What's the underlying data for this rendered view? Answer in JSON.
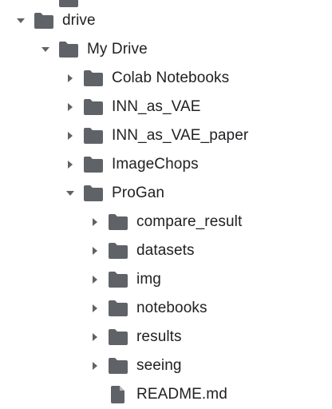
{
  "file_tree": {
    "items": [
      {
        "label": "",
        "depth": 1,
        "type": "folder",
        "expanded": false,
        "has_children": false
      },
      {
        "label": "drive",
        "depth": 0,
        "type": "folder",
        "expanded": true,
        "has_children": true
      },
      {
        "label": "My Drive",
        "depth": 1,
        "type": "folder",
        "expanded": true,
        "has_children": true
      },
      {
        "label": "Colab Notebooks",
        "depth": 2,
        "type": "folder",
        "expanded": false,
        "has_children": true
      },
      {
        "label": "INN_as_VAE",
        "depth": 2,
        "type": "folder",
        "expanded": false,
        "has_children": true
      },
      {
        "label": "INN_as_VAE_paper",
        "depth": 2,
        "type": "folder",
        "expanded": false,
        "has_children": true
      },
      {
        "label": "ImageChops",
        "depth": 2,
        "type": "folder",
        "expanded": false,
        "has_children": true
      },
      {
        "label": "ProGan",
        "depth": 2,
        "type": "folder",
        "expanded": true,
        "has_children": true
      },
      {
        "label": "compare_result",
        "depth": 3,
        "type": "folder",
        "expanded": false,
        "has_children": true
      },
      {
        "label": "datasets",
        "depth": 3,
        "type": "folder",
        "expanded": false,
        "has_children": true
      },
      {
        "label": "img",
        "depth": 3,
        "type": "folder",
        "expanded": false,
        "has_children": true
      },
      {
        "label": "notebooks",
        "depth": 3,
        "type": "folder",
        "expanded": false,
        "has_children": true
      },
      {
        "label": "results",
        "depth": 3,
        "type": "folder",
        "expanded": false,
        "has_children": true
      },
      {
        "label": "seeing",
        "depth": 3,
        "type": "folder",
        "expanded": false,
        "has_children": true
      },
      {
        "label": "README.md",
        "depth": 3,
        "type": "file",
        "expanded": false,
        "has_children": false
      }
    ]
  },
  "colors": {
    "icon": "#5f6368",
    "text": "#202124"
  },
  "icons": {
    "folder": "folder-icon",
    "file": "file-icon",
    "expanded": "caret-down-icon",
    "collapsed": "caret-right-icon"
  }
}
